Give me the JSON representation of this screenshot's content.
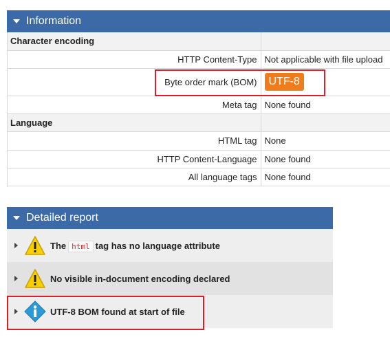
{
  "information": {
    "title": "Information",
    "sections": [
      {
        "name": "Character encoding",
        "rows": [
          {
            "key": "HTTP Content-Type",
            "value": "Not applicable with file upload"
          },
          {
            "key": "Byte order mark (BOM)",
            "badge": "UTF-8"
          },
          {
            "key": "Meta tag",
            "value": "None found"
          }
        ]
      },
      {
        "name": "Language",
        "rows": [
          {
            "key": "HTML tag",
            "value": "None"
          },
          {
            "key": "HTTP Content-Language",
            "value": "None found"
          },
          {
            "key": "All language tags",
            "value": "None found"
          }
        ]
      }
    ]
  },
  "detailed_report": {
    "title": "Detailed report",
    "items": [
      {
        "icon": "warning-icon",
        "text_before": "The",
        "code": "html",
        "text_after": "tag has no language attribute"
      },
      {
        "icon": "warning-icon",
        "text": "No visible in-document encoding declared"
      },
      {
        "icon": "info-icon",
        "text": "UTF-8 BOM found at start of file"
      }
    ]
  },
  "colors": {
    "header": "#3b6aa7",
    "badge": "#f07d1a",
    "highlight": "#d9202a",
    "warning": "#f8d000",
    "info": "#2a9bd8"
  }
}
